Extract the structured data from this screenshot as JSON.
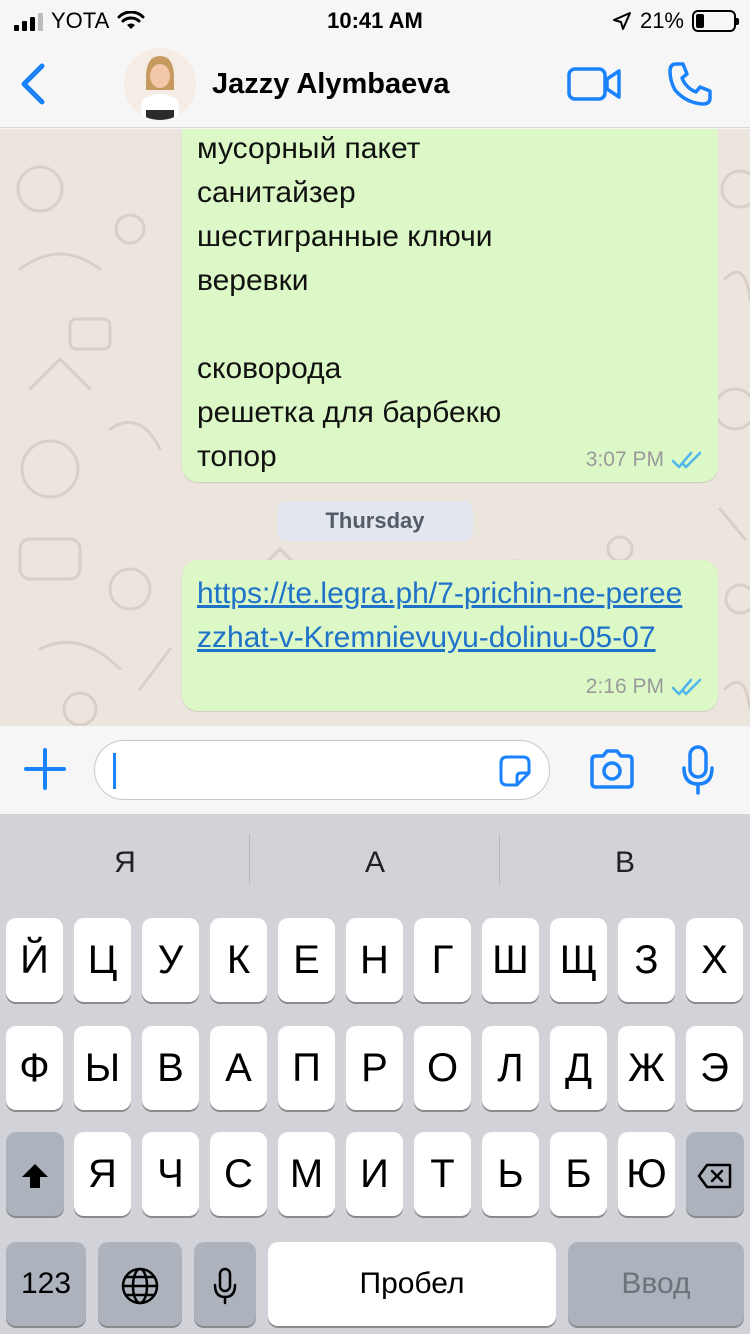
{
  "status_bar": {
    "carrier": "YOTA",
    "time": "10:41 AM",
    "battery_percent": "21%",
    "battery_level": 0.21,
    "icons": [
      "signal-icon",
      "wifi-icon",
      "location-icon",
      "battery-icon"
    ]
  },
  "header": {
    "contact_name": "Jazzy Alymbaeva",
    "icons": [
      "back-chevron-icon",
      "video-call-icon",
      "phone-call-icon"
    ],
    "accent": "#1a82fb"
  },
  "messages": [
    {
      "lines": [
        "мусорный пакет",
        "санитайзер",
        "шестигранные ключи",
        "веревки",
        "",
        "сковорода",
        "решетка для барбекю",
        "топор"
      ],
      "time": "3:07 PM",
      "status": "read"
    },
    {
      "date_separator": "Thursday"
    },
    {
      "link": "https://te.legra.ph/7-prichin-ne-pereezzhat-v-Kremnievuyu-dolinu-05-07",
      "time": "2:16 PM",
      "status": "read"
    }
  ],
  "input": {
    "value": "",
    "icons": [
      "plus-icon",
      "sticker-icon",
      "camera-icon",
      "microphone-icon"
    ]
  },
  "keyboard": {
    "suggestions": [
      "Я",
      "А",
      "В"
    ],
    "row1": [
      "Й",
      "Ц",
      "У",
      "К",
      "Е",
      "Н",
      "Г",
      "Ш",
      "Щ",
      "З",
      "Х"
    ],
    "row2": [
      "Ф",
      "Ы",
      "В",
      "А",
      "П",
      "Р",
      "О",
      "Л",
      "Д",
      "Ж",
      "Э"
    ],
    "row3": [
      "Я",
      "Ч",
      "С",
      "М",
      "И",
      "Т",
      "Ь",
      "Б",
      "Ю"
    ],
    "numbers_label": "123",
    "space_label": "Пробел",
    "return_label": "Ввод"
  },
  "colors": {
    "outgoing_bubble": "#dcf8c6",
    "chat_background": "#ece5dd",
    "link": "#1e72c8",
    "read_ticks": "#4fb6ec"
  }
}
